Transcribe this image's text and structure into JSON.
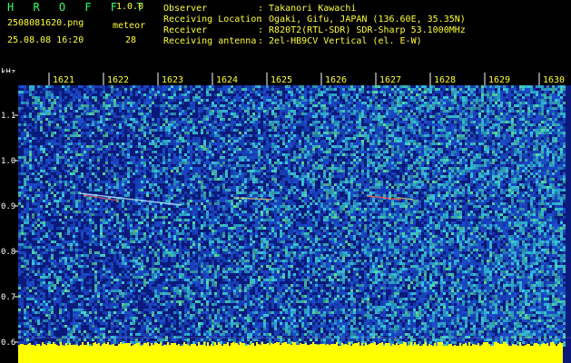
{
  "header": {
    "app_title": "H R O F F T",
    "app_version": "1.0.0",
    "file_name": "2508081620.png",
    "meteor_label": "meteor",
    "timestamp": "25.08.08 16:20",
    "meteor_count": "28",
    "info": [
      {
        "key": "Observer",
        "value": ": Takanori Kawachi"
      },
      {
        "key": "Receiving Location",
        "value": ": Ogaki, Gifu, JAPAN (136.60E, 35.35N)"
      },
      {
        "key": "Receiver",
        "value": ": R820T2(RTL-SDR) SDR-Sharp 53.1000MHz"
      },
      {
        "key": "Receiving antenna",
        "value": ": 2el-HB9CV Vertical (el. E-W)"
      }
    ]
  },
  "axis": {
    "y_unit": "kHz",
    "y_ticks": [
      "1.1",
      "1.0",
      "0.9",
      "0.8",
      "0.7",
      "0.6"
    ],
    "time_ticks": [
      "1621",
      "1622",
      "1623",
      "1624",
      "1625",
      "1626",
      "1627",
      "1628",
      "1629",
      "1630"
    ]
  },
  "colors": {
    "background": "#000000",
    "noise_dark": "#0a1a8a",
    "noise_mid": "#1e4fd0",
    "noise_light": "#38c8d8",
    "noise_green": "#58e0a0",
    "baseline": "#ffff00",
    "text_yellow": "#ffff33",
    "text_green": "#33ff66"
  }
}
